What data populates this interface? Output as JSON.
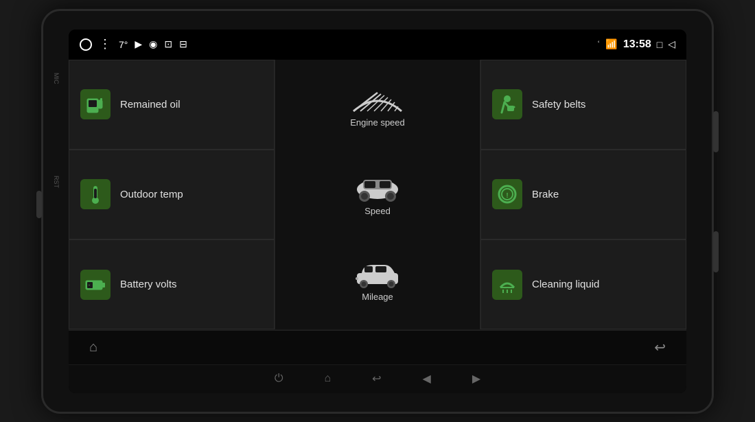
{
  "device": {
    "mic_label": "MIC",
    "rst_label": "RST"
  },
  "status_bar": {
    "temp": "7°",
    "time": "13:58",
    "bluetooth_icon": "bluetooth",
    "wifi_icon": "wifi",
    "square_icon": "□",
    "back_icon": "◁"
  },
  "tiles": {
    "remained_oil": {
      "label": "Remained oil",
      "icon": "fuel"
    },
    "outdoor_temp": {
      "label": "Outdoor temp",
      "icon": "thermometer"
    },
    "battery_volts": {
      "label": "Battery volts",
      "icon": "battery"
    },
    "safety_belts": {
      "label": "Safety belts",
      "icon": "seatbelt"
    },
    "brake": {
      "label": "Brake",
      "icon": "brake"
    },
    "cleaning_liquid": {
      "label": "Cleaning liquid",
      "icon": "washer"
    }
  },
  "center": {
    "engine_speed_label": "Engine speed",
    "speed_label": "Speed",
    "mileage_label": "Mileage"
  },
  "bottom_bar": {
    "home_icon": "⌂",
    "back_icon": "↩"
  },
  "nav_bar": {
    "power_icon": "⏻",
    "home_icon": "⌂",
    "back_icon": "↩",
    "vol_down": "◀",
    "vol_up": "▶"
  }
}
